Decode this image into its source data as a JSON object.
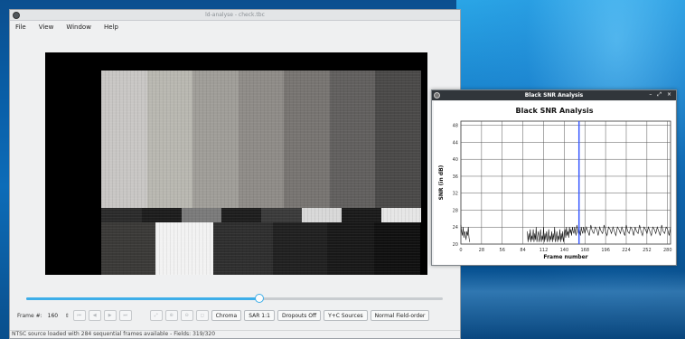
{
  "desktop": {},
  "main_window": {
    "title": "ld-analyse - check.tbc",
    "menu": [
      "File",
      "View",
      "Window",
      "Help"
    ],
    "controls": {
      "frame_label": "Frame #:",
      "frame_value": "160",
      "slider_fraction": 0.56,
      "buttons": [
        "Chroma",
        "SAR 1:1",
        "Dropouts Off",
        "Y+C Sources",
        "Normal Field-order"
      ]
    },
    "status": "NTSC source loaded with 284 sequential frames available - Fields: 319/320",
    "colors": {
      "top_bars": [
        "#c8c6c4",
        "#b8b7b0",
        "#9f9d98",
        "#8e8b87",
        "#777471",
        "#615f5e",
        "#4a4948"
      ],
      "mid_bars": [
        "#2a2a2a",
        "#1c1c1c",
        "#7a7a7a",
        "#1d1d1d",
        "#3a3a3a",
        "#d8d8d8",
        "#1a1a1a",
        "#e6e6e6"
      ],
      "bottom_bars": [
        "#3a3937",
        "#f2f2f2",
        "#2e2e2e",
        "#202020",
        "#181818",
        "#101010"
      ]
    }
  },
  "snr_window": {
    "title": "Black SNR Analysis",
    "window_controls": "– ⤢ ×",
    "accent": "#3c5cff"
  },
  "chart_data": {
    "type": "line",
    "title": "Black SNR Analysis",
    "xlabel": "Frame number",
    "ylabel": "SNR (in dB)",
    "xlim": [
      0,
      284
    ],
    "ylim": [
      20,
      49
    ],
    "xticks": [
      0,
      28,
      56,
      84,
      112,
      140,
      168,
      196,
      224,
      252,
      280
    ],
    "yticks": [
      20,
      24,
      28,
      32,
      36,
      40,
      44,
      48
    ],
    "grid": true,
    "current_frame_marker": 160,
    "series": [
      {
        "x": [
          0,
          1,
          2,
          3,
          4,
          5,
          6,
          7,
          8,
          9,
          10,
          11,
          12,
          90,
          91,
          92,
          93,
          94,
          95,
          96,
          97,
          98,
          99,
          100,
          101,
          102,
          103,
          104,
          105,
          106,
          107,
          108,
          109,
          110,
          111,
          112,
          113,
          114,
          115,
          116,
          117,
          118,
          119,
          120,
          121,
          122,
          123,
          124,
          125,
          126,
          127,
          128,
          129,
          130,
          131,
          132,
          133,
          134,
          135,
          136,
          137,
          138,
          139,
          140,
          141,
          142,
          143,
          144,
          145,
          146,
          147,
          148,
          149,
          150,
          151,
          152,
          153,
          154,
          155,
          156,
          157,
          158,
          159,
          160,
          161,
          162,
          163,
          164,
          165,
          166,
          167,
          168,
          170,
          172,
          174,
          176,
          178,
          180,
          182,
          184,
          186,
          188,
          190,
          192,
          194,
          196,
          198,
          200,
          202,
          204,
          206,
          208,
          210,
          212,
          214,
          216,
          218,
          220,
          222,
          224,
          226,
          228,
          230,
          232,
          234,
          236,
          238,
          240,
          242,
          244,
          246,
          248,
          250,
          252,
          254,
          256,
          258,
          260,
          262,
          264,
          266,
          268,
          270,
          272,
          274,
          276,
          278,
          280,
          282,
          284
        ],
        "y": [
          24.5,
          23,
          22,
          24,
          21.5,
          23,
          22.5,
          21,
          23,
          22,
          24,
          21.5,
          20.5,
          23,
          20.5,
          22.5,
          21,
          23.5,
          20.5,
          22,
          21,
          23.5,
          20.5,
          22.5,
          21,
          24,
          20.5,
          22,
          23,
          20.5,
          21.5,
          23.5,
          20.5,
          22,
          21,
          24,
          20.5,
          22.5,
          21,
          23,
          20.5,
          21.5,
          23.5,
          20.5,
          22,
          21,
          23,
          20.5,
          22.5,
          21,
          24,
          20.5,
          21.5,
          23,
          20.5,
          22,
          21,
          23.5,
          20.5,
          22.5,
          21,
          23,
          20.5,
          22,
          23.5,
          21.5,
          24,
          22,
          23,
          21.5,
          24,
          22.5,
          23.5,
          22,
          24,
          23,
          22.5,
          24,
          23,
          22,
          24.5,
          23.5,
          22.5,
          24,
          23,
          22,
          24,
          23,
          22.5,
          24,
          23.5,
          22.5,
          24,
          23,
          22,
          24.5,
          23,
          22.5,
          24,
          23.5,
          22,
          24,
          23,
          22.5,
          24.5,
          23,
          22,
          24,
          23.5,
          22.5,
          24,
          23,
          22,
          24,
          23.5,
          22.5,
          24,
          23,
          22,
          24.5,
          23,
          22.5,
          24,
          23.5,
          22,
          24,
          23,
          22.5,
          24.5,
          23,
          22,
          24,
          23.5,
          22.5,
          24,
          23,
          22,
          24,
          23.5,
          22.5,
          24,
          23,
          22,
          24.5,
          23,
          22.5,
          24,
          23.5,
          22,
          24
        ]
      }
    ]
  }
}
